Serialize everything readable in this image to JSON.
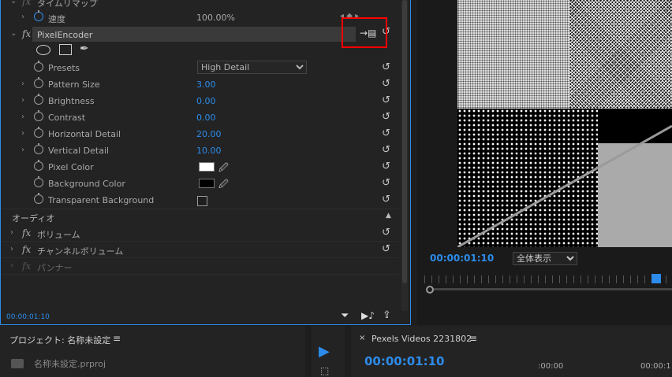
{
  "effect_controls": {
    "time_remap_label": "タイムリマップ",
    "speed_label": "速度",
    "speed_value": "100.00%",
    "effect_name": "PixelEncoder",
    "properties": [
      {
        "label": "Presets"
      },
      {
        "label": "Pattern Size",
        "value": "3.00"
      },
      {
        "label": "Brightness",
        "value": "0.00"
      },
      {
        "label": "Contrast",
        "value": "0.00"
      },
      {
        "label": "Horizontal Detail",
        "value": "20.00"
      },
      {
        "label": "Vertical Detail",
        "value": "10.00"
      },
      {
        "label": "Pixel Color"
      },
      {
        "label": "Background Color"
      },
      {
        "label": "Transparent Background"
      }
    ],
    "preset_value": "High Detail",
    "pixel_color": "#ffffff",
    "background_color": "#000000",
    "audio_section": "オーディオ",
    "audio_effects": [
      "ボリューム",
      "チャンネルボリューム",
      "パンナー"
    ],
    "footer_time": "00:00:01:10"
  },
  "monitor": {
    "timecode": "00:00:01:10",
    "zoom_option": "全体表示"
  },
  "project": {
    "title": "プロジェクト: 名称未設定",
    "file": "名称未設定.prproj"
  },
  "timeline": {
    "tab_title": "Pexels Videos 2231802",
    "timecode": "00:00:01:10",
    "ruler_start": ":00:00",
    "ruler_next": "00:00:1"
  },
  "colors": {
    "accent": "#2d8ceb",
    "highlight_box": "#ff0000"
  }
}
